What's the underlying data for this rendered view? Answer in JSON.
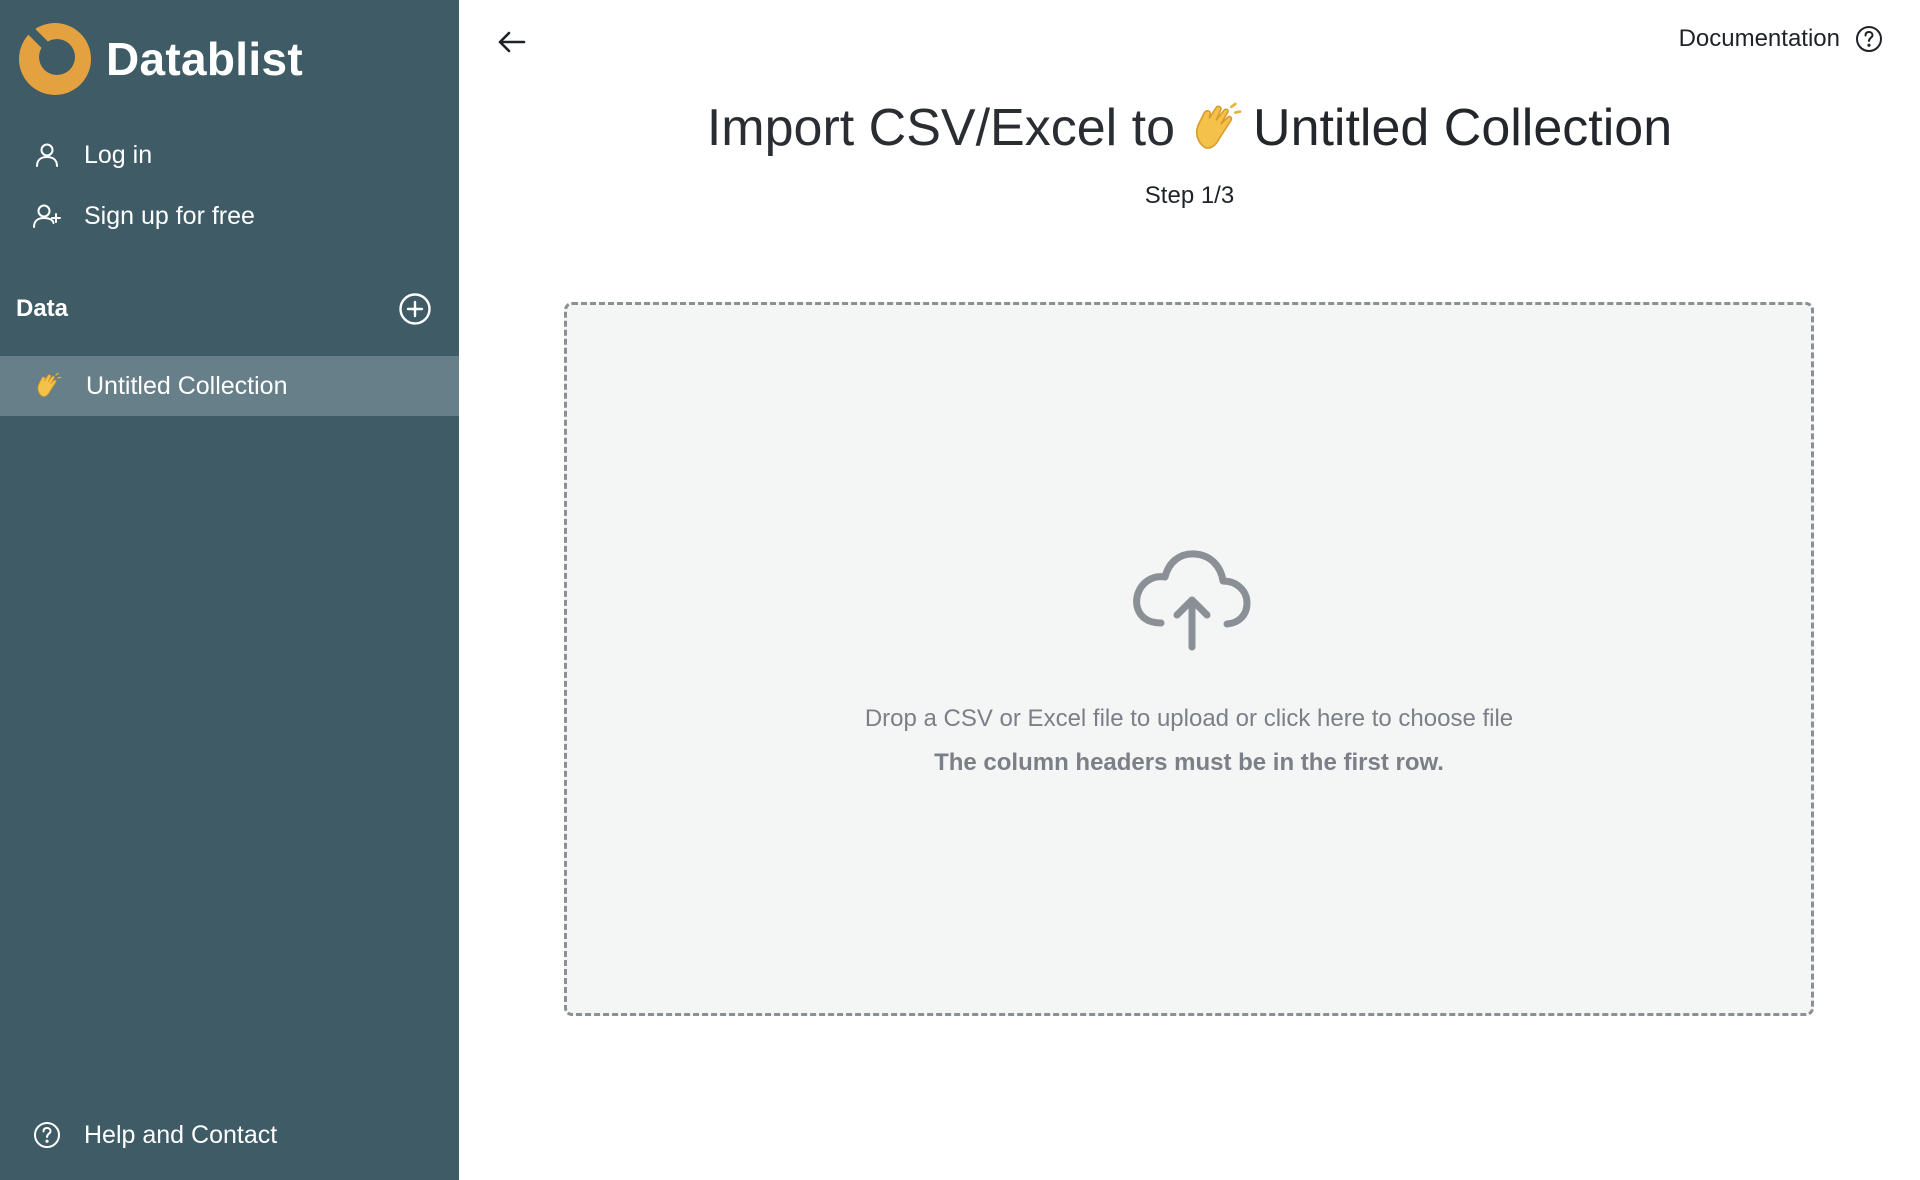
{
  "brand": {
    "name": "Datablist",
    "accent": "#e3a23f"
  },
  "nav": {
    "login_label": "Log in",
    "signup_label": "Sign up for free",
    "help_label": "Help and Contact"
  },
  "data_section": {
    "title": "Data",
    "collections": [
      {
        "label": "Untitled Collection",
        "icon": "waving-hand-emoji",
        "selected": true
      }
    ]
  },
  "header": {
    "documentation_label": "Documentation"
  },
  "import": {
    "title_prefix": "Import CSV/Excel to",
    "collection_name": "Untitled Collection",
    "step": "Step 1/3",
    "drop_text": "Drop a CSV or Excel file to upload or click here to choose file",
    "drop_hint": "The column headers must be in the first row."
  },
  "colors": {
    "sidebar_bg": "#3e5b66",
    "sidebar_selected_bg": "#667f88",
    "dropzone_bg": "#f4f5f5",
    "dropzone_border": "#8b8f96",
    "muted_text": "#7b7f87"
  }
}
